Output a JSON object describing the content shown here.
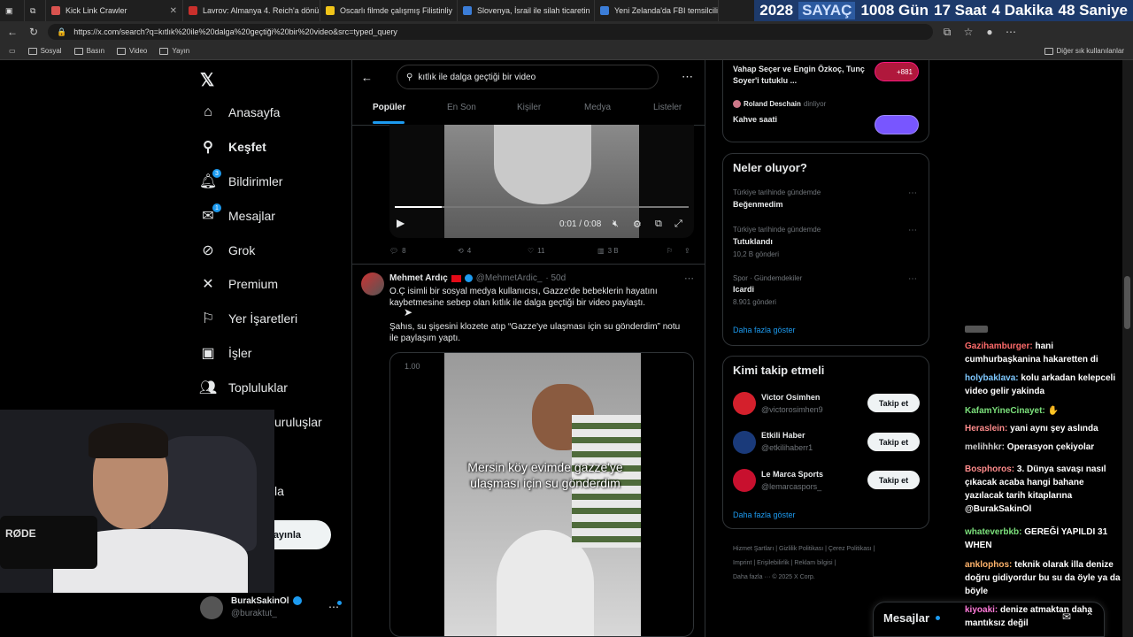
{
  "browser": {
    "tabs": [
      {
        "title": "Kick Link Crawler",
        "color": "#d9534f"
      },
      {
        "title": "Lavrov: Almanya 4. Reich'a dönü",
        "color": "#c9302c"
      },
      {
        "title": "Oscarlı filmde çalışmış Filistinliy",
        "color": "#f0c419"
      },
      {
        "title": "Slovenya, İsrail ile silah ticaretin",
        "color": "#3b7dd8"
      },
      {
        "title": "Yeni Zelanda'da FBI temsilciliği",
        "color": "#3b7dd8"
      }
    ],
    "url": "https://x.com/search?q=kıtlık%20ile%20dalga%20geçtiği%20bir%20video&src=typed_query",
    "bookmarks": [
      "Sosyal",
      "Basın",
      "Video",
      "Yayın"
    ],
    "other_bookmarks": "Diğer sık kullanılanlar"
  },
  "counter": {
    "year": "2028",
    "label": "SAYAÇ",
    "days": "1008 Gün",
    "hours": "17 Saat",
    "minutes": "4 Dakika",
    "seconds": "48 Saniye"
  },
  "nav": {
    "items": [
      {
        "label": "Anasayfa",
        "icon": "home-icon"
      },
      {
        "label": "Keşfet",
        "icon": "search-icon"
      },
      {
        "label": "Bildirimler",
        "icon": "bell-icon",
        "badge": "3"
      },
      {
        "label": "Mesajlar",
        "icon": "mail-icon",
        "badge": "1"
      },
      {
        "label": "Grok",
        "icon": "grok-icon"
      },
      {
        "label": "Premium",
        "icon": "x-icon"
      },
      {
        "label": "Yer İşaretleri",
        "icon": "bookmark-icon"
      },
      {
        "label": "İşler",
        "icon": "briefcase-icon"
      },
      {
        "label": "Topluluklar",
        "icon": "people-icon"
      },
      {
        "label": "uruluşlar",
        "icon": ""
      },
      {
        "label": "la",
        "icon": ""
      }
    ],
    "post_button": "ayınla",
    "account": {
      "name": "BurakSakinOl",
      "handle": "@buraktut_"
    }
  },
  "search": {
    "query": "kıtlık ile dalga geçtiği bir video",
    "tabs": [
      "Popüler",
      "En Son",
      "Kişiler",
      "Medya",
      "Listeler"
    ]
  },
  "tweet1": {
    "video_time": "0:01 / 0:08",
    "replies": "8",
    "retweets": "4",
    "likes": "11",
    "views": "3 B"
  },
  "tweet2": {
    "name": "Mehmet Ardıç",
    "handle": "@MehmetArdic_",
    "age": "· 50d",
    "text1": "O.Ç isimli bir sosyal medya kullanıcısı, Gazze'de bebeklerin hayatını kaybetmesine sebep olan kıtlık ile dalga geçtiği bir video paylaştı.",
    "text2": "Şahıs, su şişesini klozete atıp “Gazze'ye ulaşması için su gönderdim” notu ile paylaşım yaptı.",
    "speed": "1.00",
    "caption": "Mersin köy evimde gazze'ye ulaşması için su gönderdim"
  },
  "right": {
    "top_item1": "Vahap Seçer ve Engin Özkoç, Tunç Soyer'i tutuklu ...",
    "top_item1_count": "+881",
    "top_item2_user": "Roland Deschain",
    "top_item2_suffix": "dinliyor",
    "top_item2_title": "Kahve saati",
    "trends_title": "Neler oluyor?",
    "trends": [
      {
        "meta": "Türkiye tarihinde gündemde",
        "title": "Beğenmedim",
        "count": ""
      },
      {
        "meta": "Türkiye tarihinde gündemde",
        "title": "Tutuklandı",
        "count": "10,2 B gönderi"
      },
      {
        "meta": "Spor · Gündemdekiler",
        "title": "Icardi",
        "count": "8.901 gönderi"
      }
    ],
    "show_more": "Daha fazla göster",
    "who_title": "Kimi takip etmeli",
    "who": [
      {
        "name": "Victor Osimhen",
        "handle": "@victorosimhen9",
        "color": "#d4202c"
      },
      {
        "name": "Etkili Haber",
        "handle": "@etkilihaberr1",
        "color": "#1a3a7a"
      },
      {
        "name": "Le Marca Sports",
        "handle": "@lemarcaspors_",
        "color": "#c8102e"
      }
    ],
    "follow_label": "Takip et",
    "footer": [
      "Hizmet Şartları",
      "Gizlilik Politikası",
      "Çerez Politikası",
      "Imprint",
      "Erişilebilirlik",
      "Reklam bilgisi",
      "Daha fazla ···",
      "© 2025 X Corp."
    ],
    "messages": "Mesajlar"
  },
  "chat": [
    {
      "user": "Gazihamburger:",
      "text": "hani cumhurbaşkanina hakaretten di",
      "color": "#ff6b6b"
    },
    {
      "user": "holybaklava:",
      "text": "kolu arkadan kelepceli video gelir yakinda",
      "color": "#7ec8ff"
    },
    {
      "user": "KafamYineCinayet:",
      "text": "",
      "color": "#7be07b"
    },
    {
      "user": "Heraslein:",
      "text": "yani aynı şey aslında",
      "color": "#ff8c8c"
    },
    {
      "user": "melihhkr:",
      "text": "Operasyon çekiyolar",
      "color": "#cccccc"
    },
    {
      "user": "Bosphoros:",
      "text": "3. Dünya savaşı nasıl çıkacak acaba hangi bahane yazılacak tarih kitaplarına @BurakSakinOl",
      "color": "#ff8c8c"
    },
    {
      "user": "whateverbkb:",
      "text": "GEREĞİ YAPILDI 31 WHEN",
      "color": "#7be07b"
    },
    {
      "user": "anklophos:",
      "text": "teknik olarak illa denize doğru gidiyordur bu su da öyle ya da böyle",
      "color": "#ffb36b"
    },
    {
      "user": "kiyoaki:",
      "text": "denize atmaktan daha mantıksız değil",
      "color": "#ff7ad9"
    }
  ]
}
